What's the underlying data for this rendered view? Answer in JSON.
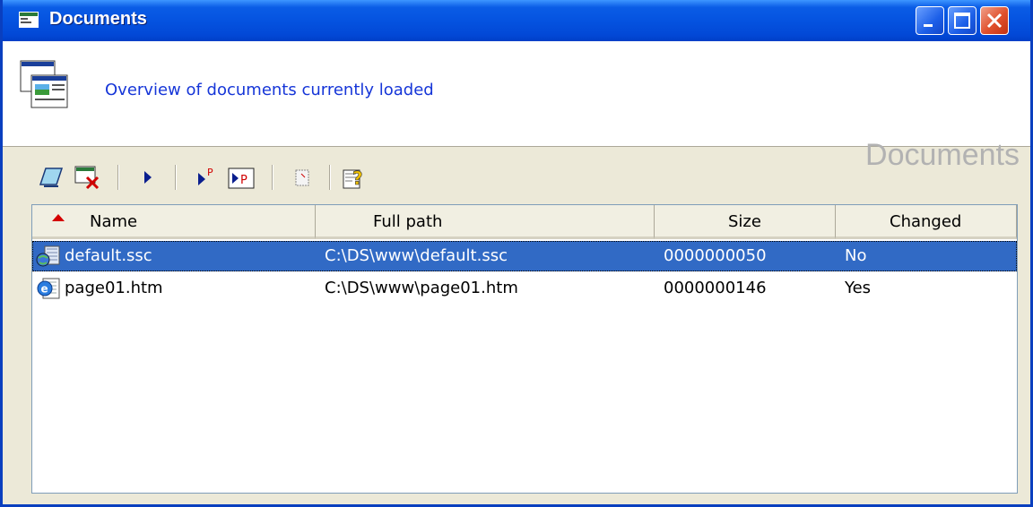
{
  "window": {
    "title": "Documents",
    "buttons": {
      "minimize": "minimize",
      "maximize": "maximize",
      "close": "close"
    }
  },
  "header": {
    "description": "Overview of documents currently loaded",
    "big_title": "Documents"
  },
  "toolbar": {
    "items": [
      "open-icon",
      "close-document-icon",
      "run-icon",
      "run-page-icon",
      "run-page-frame-icon",
      "blank-page-icon",
      "help-icon"
    ]
  },
  "list": {
    "columns": [
      "Name",
      "Full path",
      "Size",
      "Changed"
    ],
    "rows": [
      {
        "name": "default.ssc",
        "path": "C:\\DS\\www\\default.ssc",
        "size": "0000000050",
        "changed": "No",
        "icon": "ssc-file-icon",
        "selected": true
      },
      {
        "name": "page01.htm",
        "path": "C:\\DS\\www\\page01.htm",
        "size": "0000000146",
        "changed": "Yes",
        "icon": "htm-file-icon",
        "selected": false
      }
    ]
  },
  "colors": {
    "titlebar": "#0553e0",
    "selection": "#316ac5",
    "description": "#1636d8",
    "big_title": "#b2b2b2",
    "sort_arrow": "#d40000"
  }
}
